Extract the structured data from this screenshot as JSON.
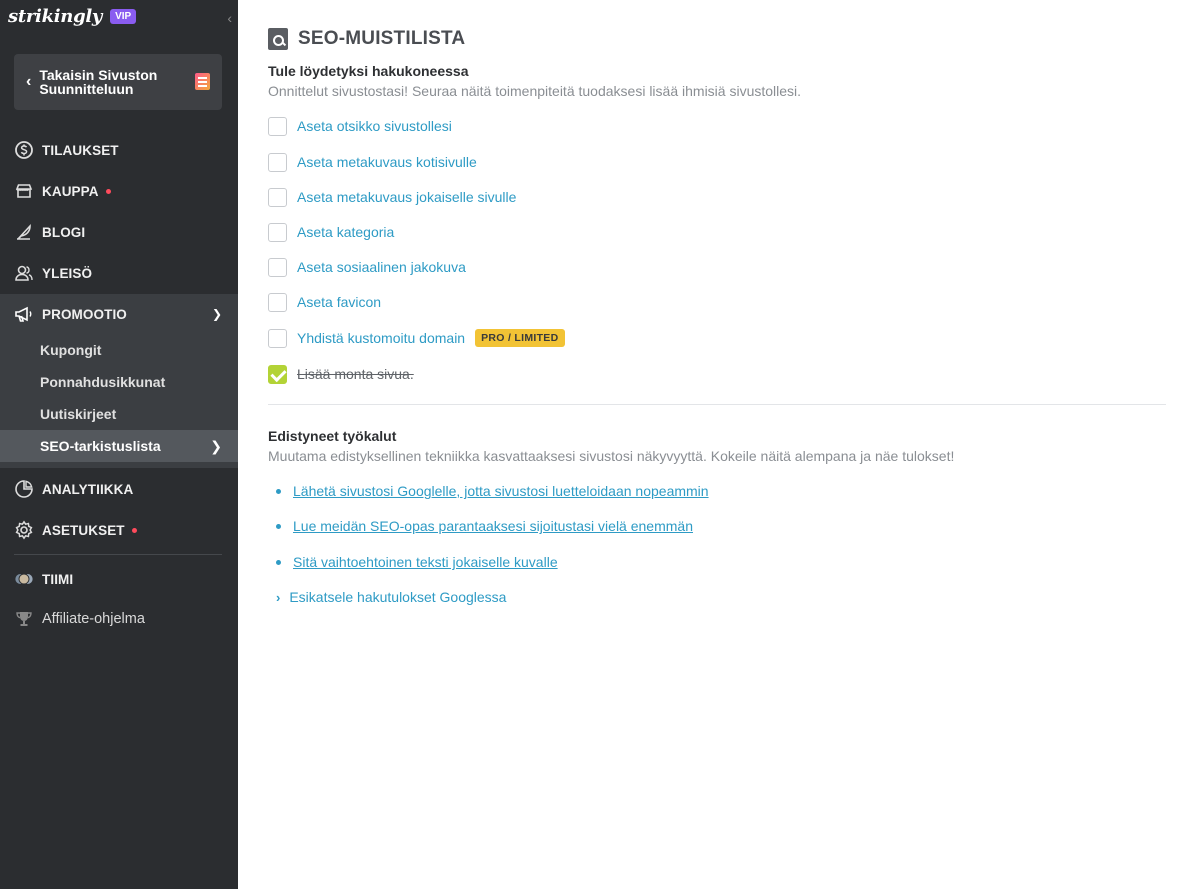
{
  "sidebar": {
    "brand": "strikingly",
    "vip": "VIP",
    "back_label": "Takaisin Sivuston Suunnitteluun",
    "nav": {
      "orders": "TILAUKSET",
      "store": "KAUPPA",
      "blog": "BLOGI",
      "audience": "YLEISÖ",
      "promotion": "PROMOOTIO",
      "analytics": "ANALYTIIKKA",
      "settings": "ASETUKSET",
      "team": "TIIMI",
      "affiliate": "Affiliate-ohjelma"
    },
    "promotion_sub": [
      "Kupongit",
      "Ponnahdusikkunat",
      "Uutiskirjeet",
      "SEO-tarkistuslista"
    ]
  },
  "main": {
    "title": "SEO-MUISTILISTA",
    "found_heading": "Tule löydetyksi hakukoneessa",
    "found_sub": "Onnittelut sivustostasi! Seuraa näitä toimenpiteitä tuodaksesi lisää ihmisiä sivustollesi.",
    "checklist": [
      {
        "label": "Aseta otsikko sivustollesi",
        "checked": false
      },
      {
        "label": "Aseta metakuvaus kotisivulle",
        "checked": false
      },
      {
        "label": "Aseta metakuvaus jokaiselle sivulle",
        "checked": false
      },
      {
        "label": "Aseta kategoria",
        "checked": false
      },
      {
        "label": "Aseta sosiaalinen jakokuva",
        "checked": false
      },
      {
        "label": "Aseta favicon",
        "checked": false
      },
      {
        "label": "Yhdistä kustomoitu domain",
        "checked": false
      },
      {
        "label": "Lisää monta sivua.",
        "checked": true
      }
    ],
    "pro_badge": "PRO / LIMITED",
    "advanced_heading": "Edistyneet työkalut",
    "advanced_sub": "Muutama edistyksellinen tekniikka kasvattaaksesi sivustosi näkyvyyttä. Kokeile näitä alempana ja näe tulokset!",
    "links": [
      "Lähetä sivustosi Googlelle, jotta sivustosi luetteloidaan nopeammin",
      "Lue meidän SEO-opas parantaaksesi sijoitustasi vielä enemmän",
      "Sitä vaihtoehtoinen teksti jokaiselle kuvalle"
    ],
    "preview": "Esikatsele hakutulokset Googlessa"
  },
  "colors": {
    "sidebar_bg": "#2b2d30",
    "accent_link": "#2e9bc5",
    "check_done": "#b3d336",
    "pro_badge": "#f2c335",
    "vip_badge": "#8a5cf0",
    "alert_dot": "#ff4b5c"
  }
}
